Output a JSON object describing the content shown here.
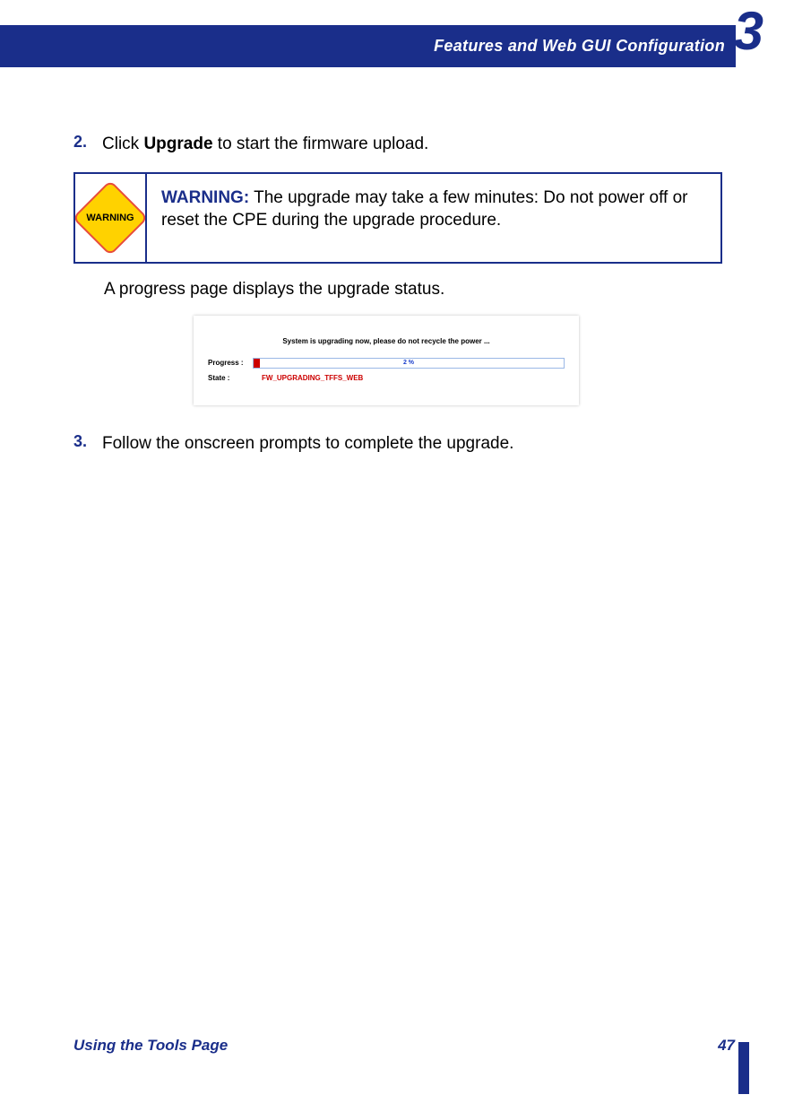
{
  "header": {
    "title": "Features and Web GUI Configuration",
    "chapter_number": "3"
  },
  "steps": {
    "s2": {
      "num": "2.",
      "pre": "Click ",
      "bold": "Upgrade",
      "post": " to start the firmware upload."
    },
    "s3": {
      "num": "3.",
      "text": "Follow the onscreen prompts to complete the upgrade."
    }
  },
  "warning": {
    "sign_text": "WARNING",
    "label": "WARNING:",
    "text": " The upgrade may take a few minutes: Do not power off or reset the CPE during the upgrade procedure."
  },
  "caption_after_warning": "A progress page displays the upgrade status.",
  "progress_shot": {
    "message": "System is upgrading now, please do not recycle the power ...",
    "progress_label": "Progress :",
    "progress_pct": "2 %",
    "progress_value": 2,
    "state_label": "State :",
    "state_value": "FW_UPGRADING_TFFS_WEB"
  },
  "footer": {
    "left": "Using the Tools Page",
    "page": "47"
  }
}
